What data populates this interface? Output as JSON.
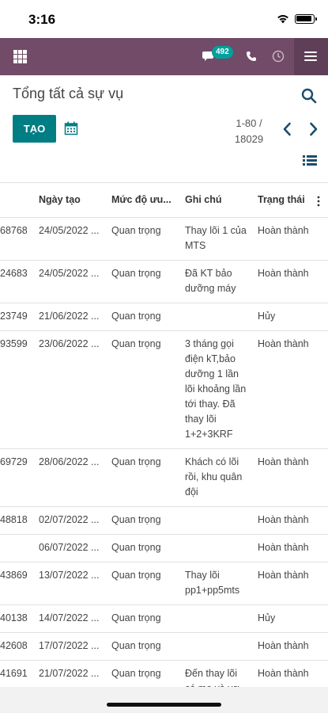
{
  "status_bar": {
    "time": "3:16"
  },
  "navbar": {
    "chat_badge": "492",
    "colors": {
      "primary": "#714b67",
      "badge": "#00a09d"
    }
  },
  "control_panel": {
    "title": "Tổng tất cả sự vụ",
    "create_label": "TẠO",
    "pager": {
      "range": "1-80 /",
      "total": "18029"
    }
  },
  "table": {
    "headers": [
      "",
      "Ngày tạo",
      "Mức độ ưu...",
      "Ghi chú",
      "Trạng thái"
    ],
    "rows": [
      {
        "ref": "68768",
        "date": "24/05/2022 ...",
        "priority": "Quan trọng",
        "note": "Thay lõi 1 của MTS",
        "status": "Hoàn thành"
      },
      {
        "ref": "24683",
        "date": "24/05/2022 ...",
        "priority": "Quan trọng",
        "note": "Đã KT bảo dưỡng máy",
        "status": "Hoàn thành"
      },
      {
        "ref": "23749",
        "date": "21/06/2022 ...",
        "priority": "Quan trọng",
        "note": "",
        "status": "Hủy"
      },
      {
        "ref": "93599",
        "date": "23/06/2022 ...",
        "priority": "Quan trọng",
        "note": "3 tháng gọi điện kT,bảo dưỡng 1 lần lõi khoảng lần tới thay. Đã thay lõi 1+2+3KRF",
        "status": "Hoàn thành"
      },
      {
        "ref": "69729",
        "date": "28/06/2022 ...",
        "priority": "Quan trọng",
        "note": "Khách có lõi rồi, khu quân đội",
        "status": "Hoàn thành"
      },
      {
        "ref": "48818",
        "date": "02/07/2022 ...",
        "priority": "Quan trọng",
        "note": "",
        "status": "Hoàn thành"
      },
      {
        "ref": "",
        "date": "06/07/2022 ...",
        "priority": "Quan trọng",
        "note": "",
        "status": "Hoàn thành"
      },
      {
        "ref": "43869",
        "date": "13/07/2022 ...",
        "priority": "Quan trọng",
        "note": "Thay lõi pp1+pp5mts",
        "status": "Hoàn thành"
      },
      {
        "ref": "40138",
        "date": "14/07/2022 ...",
        "priority": "Quan trọng",
        "note": "",
        "status": "Hủy"
      },
      {
        "ref": "42608",
        "date": "17/07/2022 ...",
        "priority": "Quan trọng",
        "note": "",
        "status": "Hoàn thành"
      },
      {
        "ref": "41691",
        "date": "21/07/2022 ...",
        "priority": "Quan trọng",
        "note": "Đến thay lõi có mẹ và vợ ở nhà quan sát,thay lõi số",
        "status": "Hoàn thành"
      }
    ]
  }
}
